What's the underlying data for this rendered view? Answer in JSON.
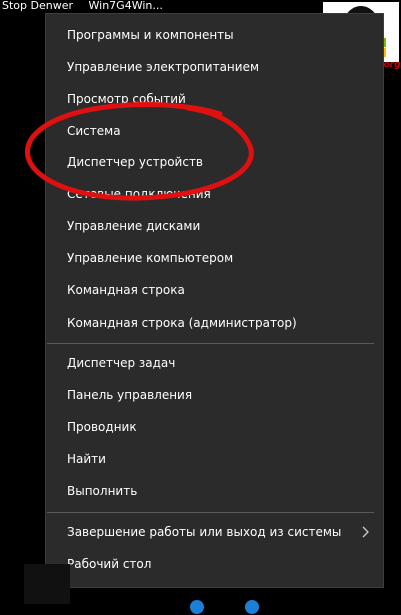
{
  "desktop": {
    "label_1": "Stop Denwer",
    "label_2": "Win7G4Win..."
  },
  "logo": {
    "caption": "pyatilistnik.org"
  },
  "menu": {
    "groups": [
      {
        "items": [
          {
            "label": "Программы и компоненты"
          },
          {
            "label": "Управление электропитанием"
          },
          {
            "label": "Просмотр событий"
          },
          {
            "label": "Система"
          },
          {
            "label": "Диспетчер устройств"
          },
          {
            "label": "Сетевые подключения"
          },
          {
            "label": "Управление дисками"
          },
          {
            "label": "Управление компьютером"
          },
          {
            "label": "Командная строка"
          },
          {
            "label": "Командная строка (администратор)"
          }
        ]
      },
      {
        "items": [
          {
            "label": "Диспетчер задач"
          },
          {
            "label": "Панель управления"
          },
          {
            "label": "Проводник"
          },
          {
            "label": "Найти"
          },
          {
            "label": "Выполнить"
          }
        ]
      },
      {
        "items": [
          {
            "label": "Завершение работы или выход из системы",
            "submenu_icon": "chevron-right-icon"
          },
          {
            "label": "Рабочий стол"
          }
        ]
      }
    ]
  },
  "colors": {
    "menu_bg": "#2b2b2b",
    "text": "#ffffff",
    "separator": "#5a5a5a",
    "highlight_circle": "#e01010"
  }
}
